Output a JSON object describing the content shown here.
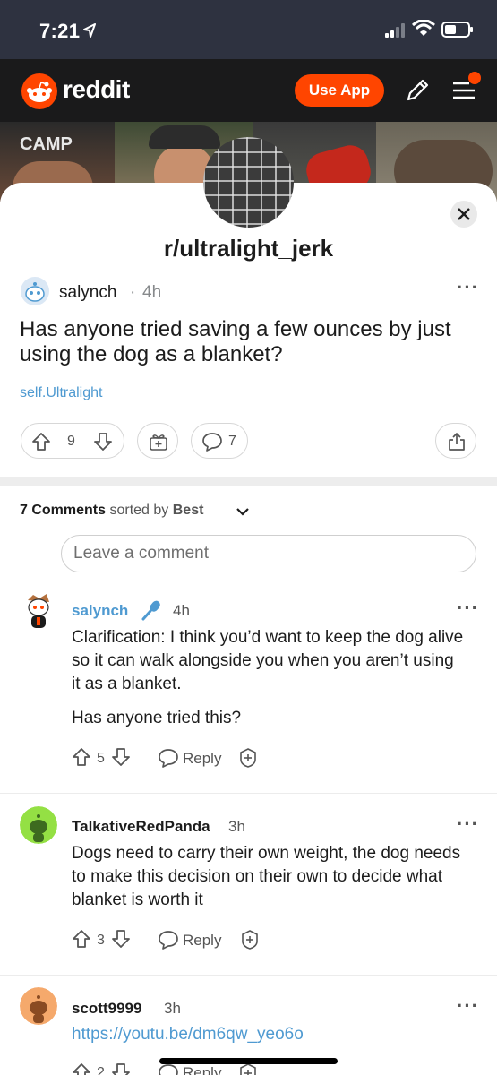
{
  "status_bar": {
    "time": "7:21"
  },
  "header": {
    "brand": "reddit",
    "use_app_label": "Use App"
  },
  "banner": {
    "camp_text": "CAMP"
  },
  "subreddit": {
    "name": "r/ultralight_jerk"
  },
  "post": {
    "author": "salynch",
    "separator": "·",
    "age": "4h",
    "title": "Has anyone tried saving a few ounces by just using the dog as a blanket?",
    "flair": "self.Ultralight",
    "score": "9",
    "comment_count": "7"
  },
  "comments_header": {
    "count_label": "7 Comments",
    "sorted_by": "sorted by",
    "sort": "Best"
  },
  "comment_input": {
    "placeholder": "Leave a comment"
  },
  "comments": [
    {
      "author": "salynch",
      "author_color": "#4f9ad1",
      "age": "4h",
      "body": "Clarification: I think you’d want to keep the dog alive so it can walk alongside you when you aren’t using it as a blanket.",
      "body2": "Has anyone tried this?",
      "score": "5",
      "reply": "Reply"
    },
    {
      "author": "TalkativeRedPanda",
      "author_color": "#1c1c1c",
      "age": "3h",
      "body": "Dogs need to carry their own weight, the dog needs to make this decision on their own to decide what blanket is worth it",
      "score": "3",
      "reply": "Reply"
    },
    {
      "author": "scott9999",
      "author_color": "#1c1c1c",
      "age": "3h",
      "link": "https://youtu.be/dm6qw_yeo6o",
      "score": "2",
      "reply": "Reply"
    }
  ],
  "icons": [
    "location-arrow-icon",
    "signal-icon",
    "wifi-icon",
    "battery-icon",
    "snoo-icon",
    "pencil-icon",
    "menu-icon",
    "close-icon",
    "upvote-icon",
    "downvote-icon",
    "award-icon",
    "comment-icon",
    "share-icon",
    "chevron-down-icon",
    "microphone-icon"
  ],
  "colors": {
    "brand": "#ff4500",
    "link": "#4f9ad1",
    "header_bg": "#1a1a1b",
    "status_bg": "#2e3240"
  }
}
